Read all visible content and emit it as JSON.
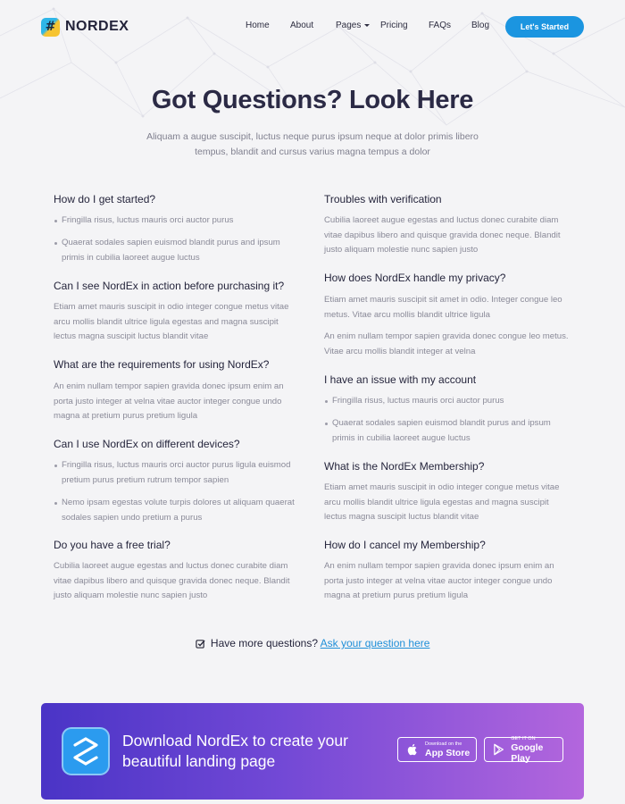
{
  "header": {
    "logo_text": "NORDEX",
    "logo_glyph": "#",
    "nav": [
      {
        "label": "Home"
      },
      {
        "label": "About"
      },
      {
        "label": "Pages",
        "has_dropdown": true
      },
      {
        "label": "Pricing"
      },
      {
        "label": "FAQs"
      },
      {
        "label": "Blog"
      }
    ],
    "cta_label": "Let's Started"
  },
  "hero": {
    "title": "Got Questions? Look Here",
    "subtitle": "Aliquam a augue suscipit, luctus neque purus ipsum neque at dolor primis libero tempus, blandit and cursus varius magna tempus a dolor"
  },
  "faq_left": [
    {
      "question": "How do I get started?",
      "bullets": [
        "Fringilla risus, luctus mauris orci auctor purus",
        "Quaerat sodales sapien euismod blandit purus and ipsum primis in cubilia laoreet augue luctus"
      ]
    },
    {
      "question": "Can I see NordEx in action before purchasing it?",
      "answer": "Etiam amet mauris suscipit in odio integer congue metus vitae arcu mollis blandit ultrice ligula egestas and magna suscipit lectus magna suscipit luctus blandit vitae"
    },
    {
      "question": "What are the requirements for using NordEx?",
      "answer": "An enim nullam tempor sapien gravida donec ipsum enim an porta justo integer at velna vitae auctor integer congue undo magna at pretium purus pretium ligula"
    },
    {
      "question": "Can I use NordEx on different devices?",
      "bullets": [
        "Fringilla risus, luctus mauris orci auctor purus ligula euismod pretium purus pretium rutrum tempor sapien",
        "Nemo ipsam egestas volute turpis dolores ut aliquam quaerat sodales sapien undo pretium a purus"
      ]
    },
    {
      "question": "Do you have a free trial?",
      "answer": "Cubilia laoreet augue egestas and luctus donec curabite diam vitae dapibus libero and quisque gravida donec neque. Blandit justo aliquam molestie nunc sapien justo"
    }
  ],
  "faq_right": [
    {
      "question": "Troubles with verification",
      "answer": "Cubilia laoreet augue egestas and luctus donec curabite diam vitae dapibus libero and quisque gravida donec neque. Blandit justo aliquam molestie nunc sapien justo"
    },
    {
      "question": "How does NordEx handle my privacy?",
      "answer": "Etiam amet mauris suscipit sit amet in odio. Integer congue leo metus. Vitae arcu mollis blandit ultrice ligula",
      "answer2": "An enim nullam tempor sapien gravida donec congue leo metus. Vitae arcu mollis blandit integer at velna"
    },
    {
      "question": "I have an issue with my account",
      "bullets": [
        "Fringilla risus, luctus mauris orci auctor purus",
        "Quaerat sodales sapien euismod blandit purus and ipsum primis in cubilia laoreet augue luctus"
      ]
    },
    {
      "question": "What is the NordEx Membership?",
      "answer": "Etiam amet mauris suscipit in odio integer congue metus vitae arcu mollis blandit ultrice ligula egestas and magna suscipit lectus magna suscipit luctus blandit vitae"
    },
    {
      "question": "How do I cancel my Membership?",
      "answer": "An enim nullam tempor sapien gravida donec ipsum enim an porta justo integer at velna vitae auctor integer congue undo magna at pretium purus pretium ligula"
    }
  ],
  "ask": {
    "prefix": "Have more questions?",
    "link": "Ask your question here"
  },
  "banner": {
    "text": "Download NordEx to create your beautiful landing page",
    "app_store_small": "Download on the",
    "app_store_big": "App Store",
    "google_play_small": "GET IT ON",
    "google_play_big": "Google Play"
  },
  "colors": {
    "accent": "#1b95e0",
    "link": "#1f8fd8",
    "heading": "#2b2a45",
    "banner_start": "#4a34c6",
    "banner_end": "#b366dd"
  }
}
